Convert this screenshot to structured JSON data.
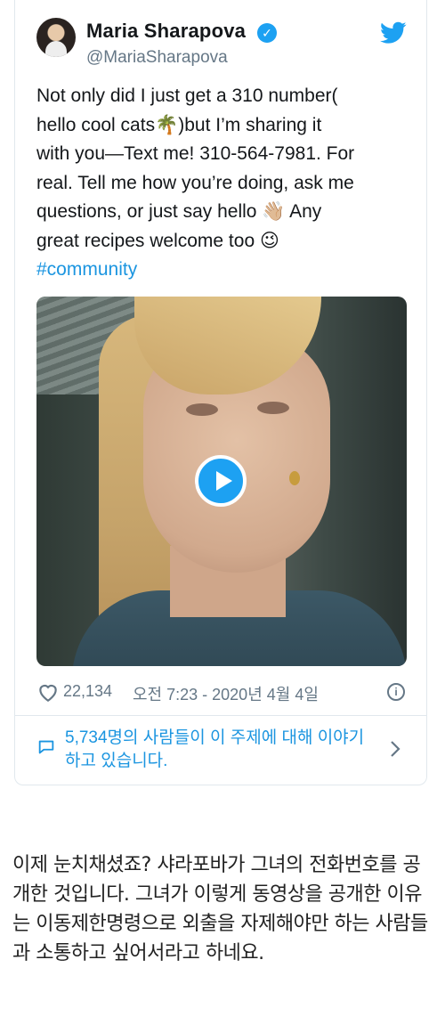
{
  "tweet": {
    "author_name": "Maria Sharapova",
    "author_handle": "@MariaSharapova",
    "text_lines": [
      "Not only did I just get a 310 number(",
      "hello cool cats🌴)but I’m sharing it",
      "with you—Text me! 310-564-7981. For",
      "real. Tell me how you’re doing, ask me",
      "questions, or just say hello 👋🏼 Any",
      "great recipes welcome too 😉"
    ],
    "hashtag": "#community",
    "likes": "22,134",
    "timestamp": "오전 7:23 - 2020년 4월 4일",
    "conversation": "5,734명의 사람들이 이 주제에 대해 이야기하고 있습니다.",
    "colors": {
      "accent": "#1da1f2",
      "link": "#1b95e0",
      "muted": "#657786"
    }
  },
  "article": {
    "paragraph": "이제 눈치채셨죠? 샤라포바가 그녀의 전화번호를 공개한 것입니다. 그녀가 이렇게 동영상을 공개한 이유는 이동제한명령으로 외출을 자제해야만 하는 사람들과 소통하고 싶어서라고 하네요."
  }
}
